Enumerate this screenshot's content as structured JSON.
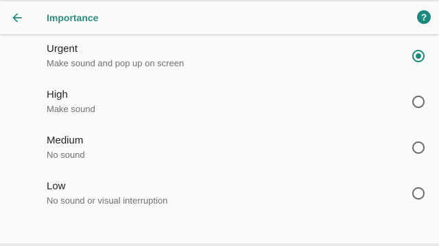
{
  "toolbar": {
    "title": "Importance",
    "back_icon": "arrow-left-icon",
    "help_icon": "help-circle-icon",
    "help_glyph": "?"
  },
  "colors": {
    "accent": "#1a8a7e",
    "title_text": "#212121",
    "subtitle_text": "#6f6f6f",
    "background": "#fafafa"
  },
  "options": [
    {
      "label": "Urgent",
      "description": "Make sound and pop up on screen",
      "selected": true
    },
    {
      "label": "High",
      "description": "Make sound",
      "selected": false
    },
    {
      "label": "Medium",
      "description": "No sound",
      "selected": false
    },
    {
      "label": "Low",
      "description": "No sound or visual interruption",
      "selected": false
    }
  ]
}
